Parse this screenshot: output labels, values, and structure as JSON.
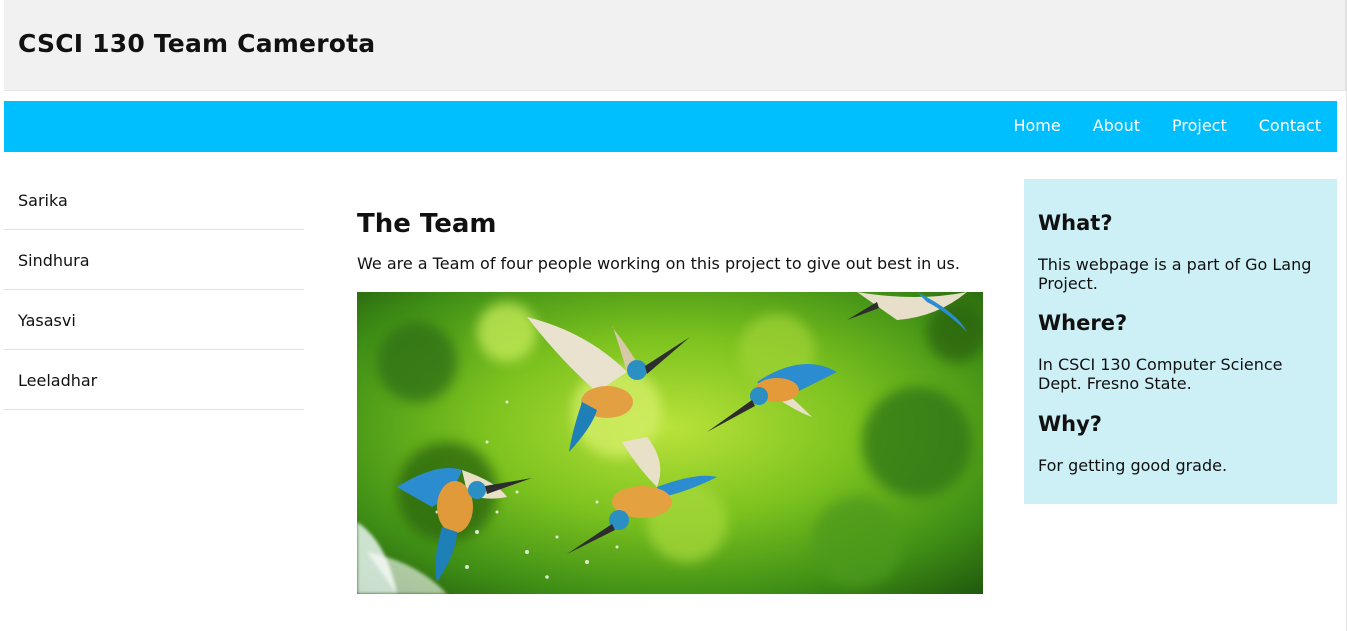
{
  "header": {
    "title": "CSCI 130 Team Camerota"
  },
  "nav": {
    "links": [
      {
        "label": "Home"
      },
      {
        "label": "About"
      },
      {
        "label": "Project"
      },
      {
        "label": "Contact"
      }
    ]
  },
  "sidebar": {
    "items": [
      {
        "label": "Sarika"
      },
      {
        "label": "Sindhura"
      },
      {
        "label": "Yasasvi"
      },
      {
        "label": "Leeladhar"
      }
    ]
  },
  "main": {
    "title": "The Team",
    "text": "We are a Team of four people working on this project to give out best in us.",
    "image": {
      "subject": "kingfishers-photo"
    }
  },
  "aside": {
    "what_heading": "What?",
    "what_text": "This webpage is a part of Go Lang Project.",
    "where_heading": "Where?",
    "where_text": "In CSCI 130 Computer Science Dept. Fresno State.",
    "why_heading": "Why?",
    "why_text": "For getting good grade."
  },
  "colors": {
    "navbar": "#00bfff",
    "header_bg": "#f1f1f1",
    "aside_bg": "#ccf0f6"
  }
}
